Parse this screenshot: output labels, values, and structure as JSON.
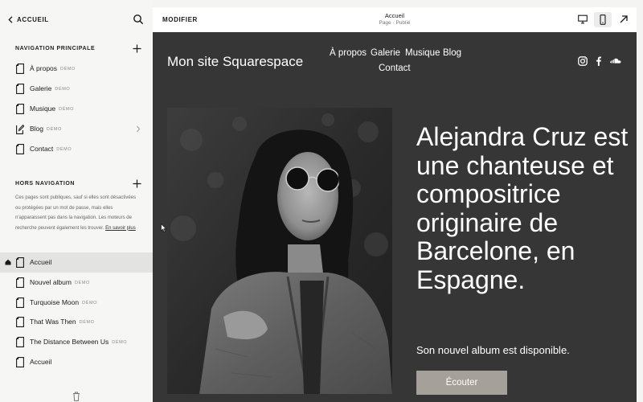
{
  "sidebar": {
    "back_label": "ACCUEIL",
    "main_nav_title": "NAVIGATION PRINCIPALE",
    "main_nav": [
      {
        "label": "À propos",
        "badge": "DÉMO"
      },
      {
        "label": "Galerie",
        "badge": "DÉMO"
      },
      {
        "label": "Musique",
        "badge": "DÉMO"
      },
      {
        "label": "Blog",
        "badge": "DÉMO"
      },
      {
        "label": "Contact",
        "badge": "DÉMO"
      }
    ],
    "other_nav_title": "HORS NAVIGATION",
    "info_text": "Ces pages sont publiques, sauf si elles sont désactivées ou protégées par un mot de passe, mais elles n'apparaissent pas dans la navigation. Les moteurs de recherche peuvent également les trouver.",
    "info_link": "En savoir plus",
    "other_nav": [
      {
        "label": "Accueil",
        "badge": ""
      },
      {
        "label": "Nouvel album",
        "badge": "DÉMO"
      },
      {
        "label": "Turquoise Moon",
        "badge": "DÉMO"
      },
      {
        "label": "That Was Then",
        "badge": "DÉMO"
      },
      {
        "label": "The Distance Between Us",
        "badge": "DÉMO"
      },
      {
        "label": "Accueil",
        "badge": ""
      }
    ]
  },
  "topbar": {
    "edit_label": "MODIFIER",
    "page_title": "Accueil",
    "page_subtitle": "Page · Publié"
  },
  "site": {
    "title": "Mon site Squarespace",
    "nav": [
      "À propos",
      "Galerie",
      "Musique",
      "Blog",
      "Contact"
    ],
    "social_icons": [
      "instagram-icon",
      "facebook-icon",
      "soundcloud-icon"
    ],
    "headline": "Alejandra Cruz est une chanteuse et compositrice originaire de Barcelone, en Espagne.",
    "subheadline": "Son nouvel album est disponible.",
    "cta_label": "Écouter"
  },
  "colors": {
    "preview_bg": "#363636",
    "button_bg": "#a5a099",
    "sidebar_bg": "#f6f6f4",
    "active_row": "#e3e3e1"
  }
}
